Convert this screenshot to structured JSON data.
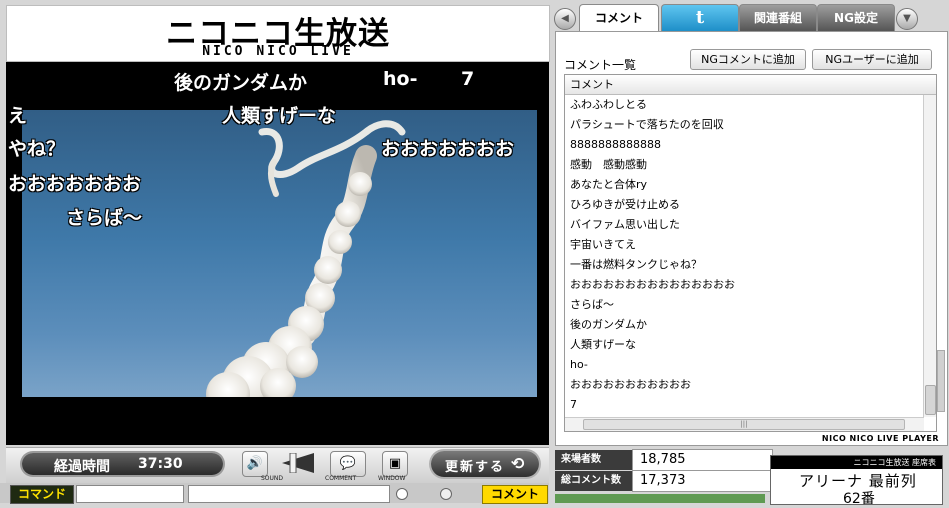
{
  "logo": {
    "title": "ニコニコ生放送",
    "subtitle": "NICO NICO LIVE"
  },
  "overlay_comments": [
    "後のガンダムか",
    "ho-",
    "7",
    "え",
    "人類すげーな",
    "やね？",
    "おおおおおおお",
    "おおおおおおお",
    "さらば～"
  ],
  "tabs": {
    "comment": "コメント",
    "twitter": "t",
    "related": "関連番組",
    "ng": "NG設定"
  },
  "panel": {
    "heading": "コメント一覧",
    "ng_comment_button": "NGコメントに追加",
    "ng_user_button": "NGユーザーに追加",
    "column_header": "コメント",
    "comments": [
      "ふわふわしとる",
      "パラシュートで落ちたのを回収",
      "8888888888888",
      "感動　感動感動",
      "あなたと合体ry",
      "ひろゆきが受け止める",
      "バイファム思い出した",
      "宇宙いきてえ",
      "一番は燃料タンクじゃね？",
      "おおおおおおおおおおおおおおお",
      "さらば～",
      "後のガンダムか",
      "人類すげーな",
      "ho-",
      "おおおおおおおおおおお",
      "7"
    ],
    "player_tag": "NICO NICO LIVE PLAYER"
  },
  "controls": {
    "elapsed_label": "経過時間",
    "elapsed_value": "37:30",
    "sound_label": "SOUND",
    "comment_label": "COMMENT",
    "window_label": "WINDOW",
    "update_label": "更新する"
  },
  "command_row": {
    "command_label": "コマンド",
    "send_label": "コメント"
  },
  "stats": {
    "visitors_label": "来場者数",
    "visitors_value": "18,785",
    "comments_label": "総コメント数",
    "comments_value": "17,373"
  },
  "ticket": {
    "header": "ニコニコ生放送 座席表",
    "seat": "アリーナ 最前列",
    "number": "62番"
  }
}
